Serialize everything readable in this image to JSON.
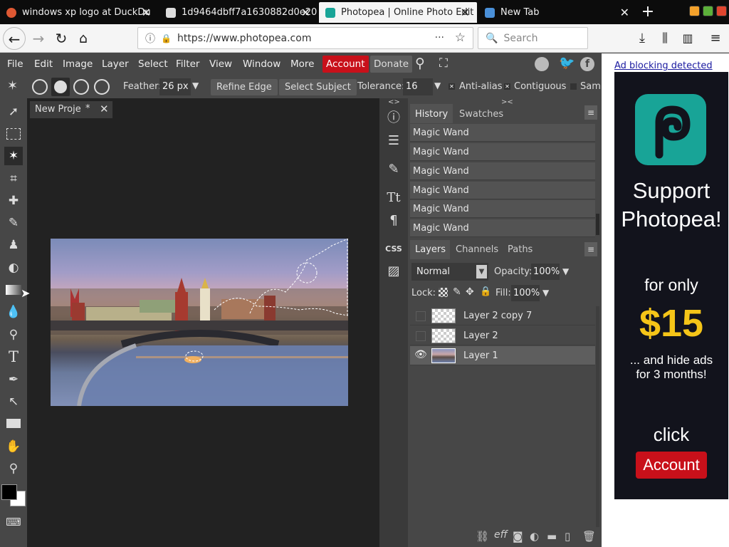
{
  "browser": {
    "tabs": [
      {
        "title": "windows xp logo at DuckDu",
        "active": false,
        "favicon_color": "#de5833"
      },
      {
        "title": "1d9464dbff7a1630882d0e20",
        "active": false,
        "favicon_color": "#ffffff"
      },
      {
        "title": "Photopea | Online Photo Edit",
        "active": true,
        "favicon_color": "#18a497"
      },
      {
        "title": "New Tab",
        "active": false,
        "favicon_color": "#4a90d9"
      }
    ],
    "url": "https://www.photopea.com",
    "url_menu": "···",
    "search_placeholder": "Search"
  },
  "menu": {
    "items": [
      "File",
      "Edit",
      "Image",
      "Layer",
      "Select",
      "Filter",
      "View",
      "Window",
      "More"
    ],
    "account_label": "Account",
    "donate_label": "Donate",
    "ad_notice": "Ad blocking detected"
  },
  "options": {
    "feather_label": "Feather:",
    "feather_value": "26 px",
    "refine_edge": "Refine Edge",
    "select_subject": "Select Subject",
    "tolerance_label": "Tolerance:",
    "tolerance_value": "16",
    "anti_alias": "Anti-alias",
    "contiguous": "Contiguous",
    "sample": "Samp"
  },
  "document": {
    "tab_title": "New Proje",
    "modified_marker": "*"
  },
  "side": {
    "css_label": "CSS"
  },
  "history": {
    "tab": "History",
    "swatches_tab": "Swatches",
    "items": [
      "Magic Wand",
      "Magic Wand",
      "Magic Wand",
      "Magic Wand",
      "Magic Wand",
      "Magic Wand"
    ]
  },
  "layers": {
    "tabs": [
      "Layers",
      "Channels",
      "Paths"
    ],
    "blend_mode": "Normal",
    "opacity_label": "Opacity:",
    "opacity_value": "100%",
    "lock_label": "Lock:",
    "fill_label": "Fill:",
    "fill_value": "100%",
    "items": [
      {
        "name": "Layer 2 copy 7",
        "visible": false,
        "selected": false
      },
      {
        "name": "Layer 2",
        "visible": false,
        "selected": false
      },
      {
        "name": "Layer 1",
        "visible": true,
        "selected": true
      }
    ],
    "footer_eff": "eff"
  },
  "ad": {
    "line1": "Support",
    "line2": "Photopea!",
    "for_only": "for only",
    "price": "$15",
    "hide_ads_1": "... and hide ads",
    "hide_ads_2": "for 3 months!",
    "click": "click",
    "account_button": "Account",
    "logo_color": "#18a497",
    "price_color": "#f5c518",
    "button_color": "#c8101a"
  },
  "colors": {
    "account_bg": "#c8101a",
    "panel_bg": "#474747",
    "workspace_bg": "#222222"
  }
}
